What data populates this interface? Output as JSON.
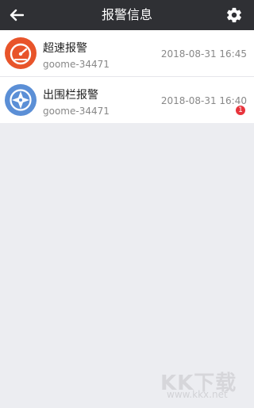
{
  "header": {
    "title": "报警信息",
    "back_icon": "arrow-left-icon",
    "settings_icon": "gear-icon"
  },
  "alarms": [
    {
      "type": "超速报警",
      "device": "goome-34471",
      "time": "2018-08-31 16:45",
      "icon": "speedometer-icon",
      "icon_color": "#e8542a"
    },
    {
      "type": "出围栏报警",
      "device": "goome-34471",
      "time": "2018-08-31 16:40",
      "icon": "compass-icon",
      "icon_color": "#5b8fd6",
      "unread": "1"
    }
  ],
  "watermark": {
    "text": "KK下载",
    "sub": "www.kkx.net"
  }
}
